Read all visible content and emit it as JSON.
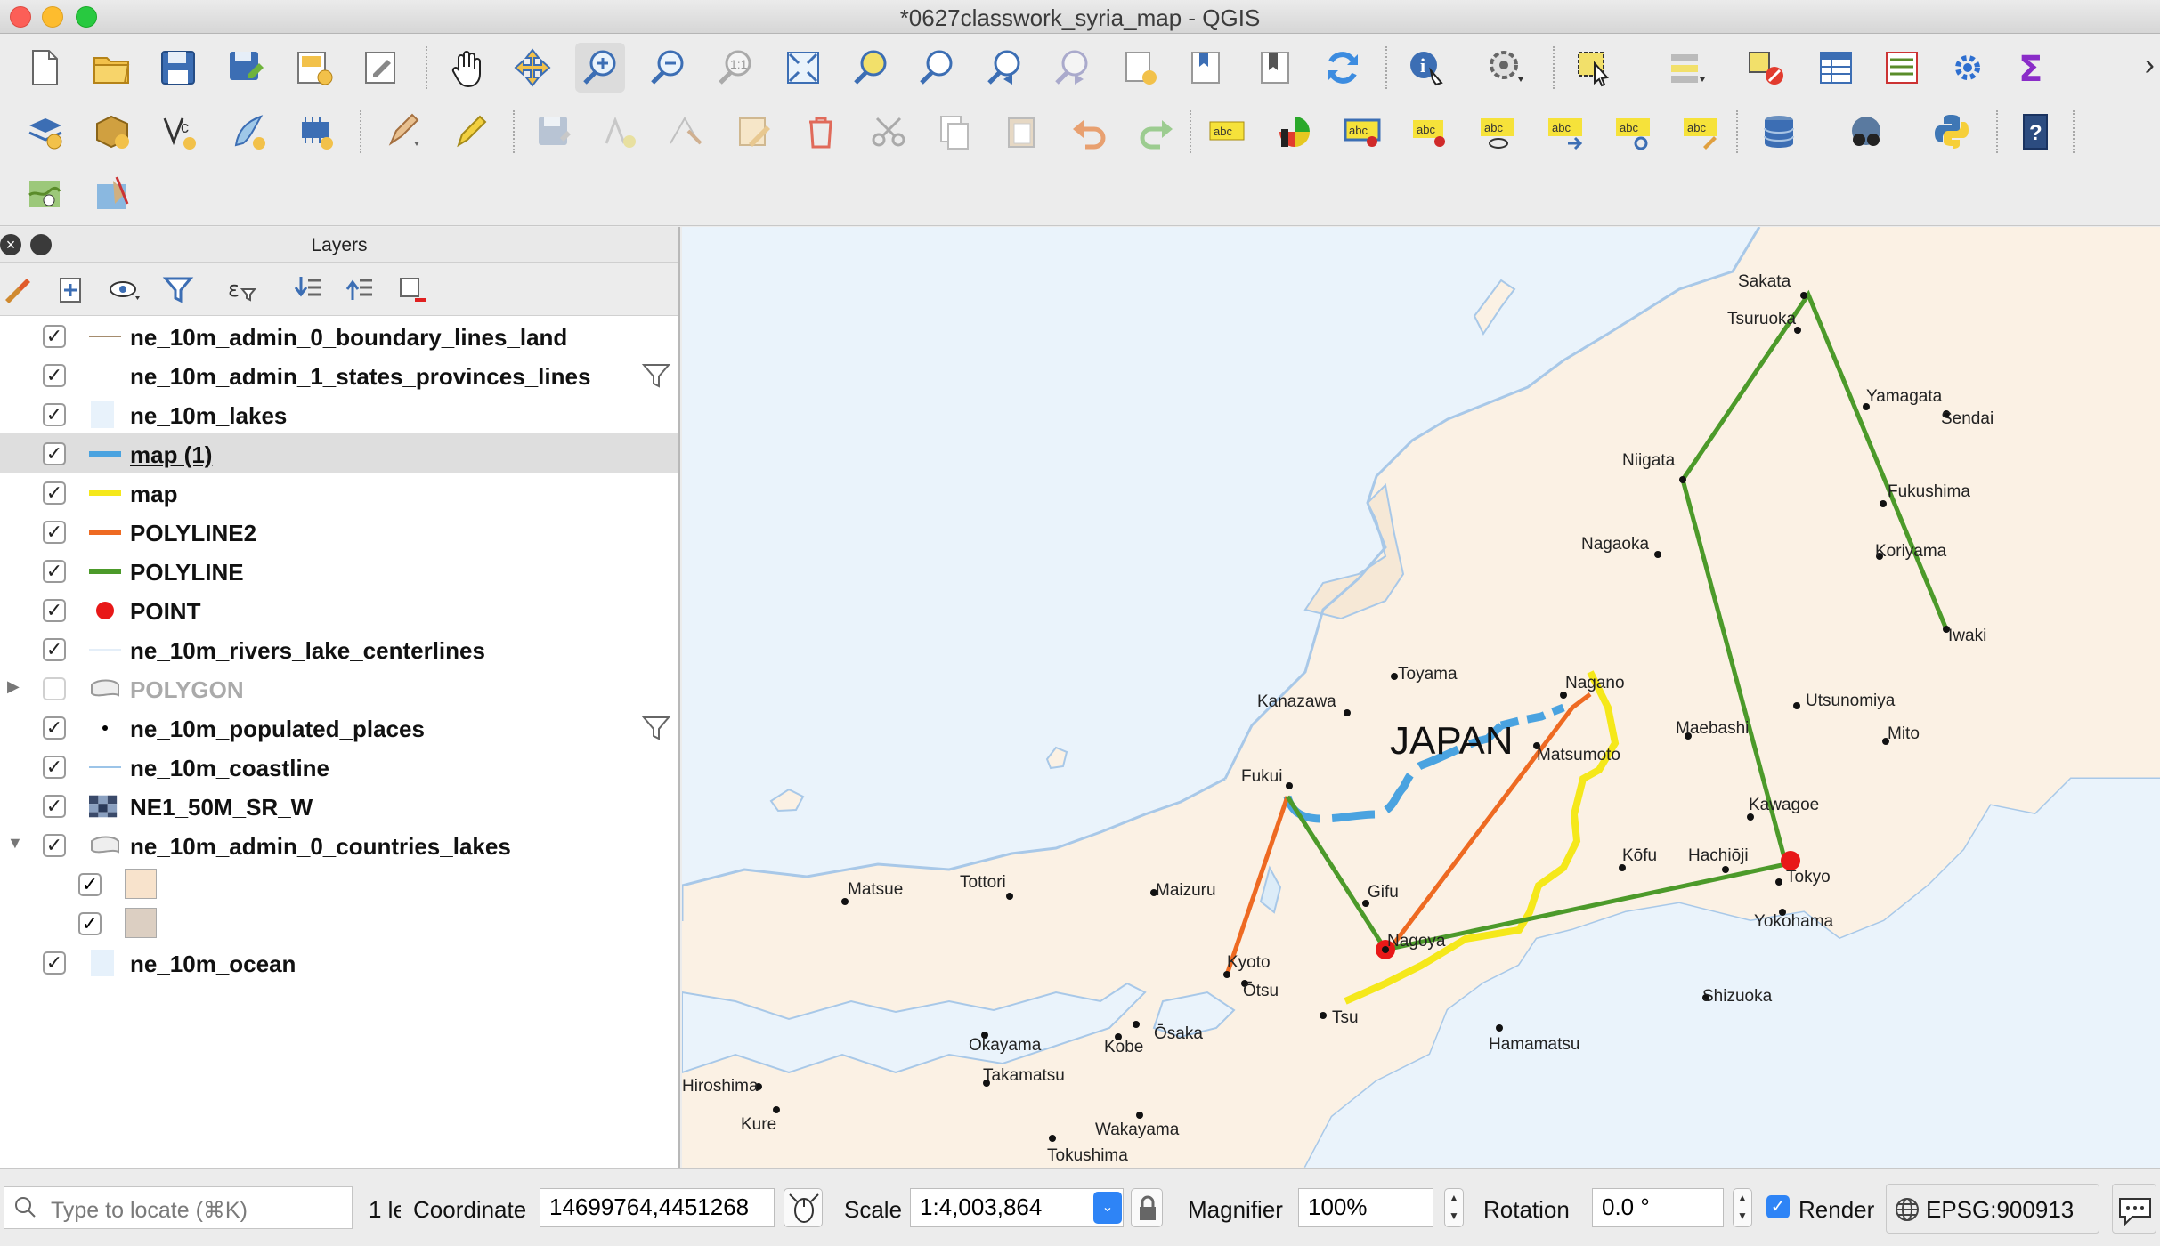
{
  "window": {
    "title": "*0627classwork_syria_map - QGIS"
  },
  "toolbar_icons": {
    "row1": [
      "new-project-icon",
      "open-project-icon",
      "save-project-icon",
      "save-as-icon",
      "new-print-layout-icon",
      "layout-manager-icon",
      "pan-icon",
      "pan-to-selection-icon",
      "zoom-in-icon",
      "zoom-out-icon",
      "zoom-actual-icon",
      "zoom-full-icon",
      "zoom-selection-icon",
      "zoom-layer-icon",
      "zoom-last-icon",
      "zoom-next-icon",
      "new-bookmark-icon",
      "show-bookmarks-icon",
      "map-tips-icon",
      "refresh-icon",
      "identify-icon",
      "run-feature-action-icon",
      "select-features-icon",
      "select-by-value-icon",
      "deselect-icon",
      "attribute-table-icon",
      "field-calculator-icon",
      "processing-toolbox-icon",
      "statistics-icon"
    ],
    "row2": [
      "data-source-manager-icon",
      "new-geopackage-icon",
      "new-shapefile-icon",
      "new-spatialite-icon",
      "new-virtual-layer-icon",
      "current-edits-icon",
      "toggle-editing-icon",
      "save-edits-icon",
      "add-feature-icon",
      "vertex-tool-icon",
      "modify-attributes-icon",
      "delete-selected-icon",
      "cut-features-icon",
      "copy-features-icon",
      "paste-features-icon",
      "undo-icon",
      "redo-icon",
      "label-icon",
      "diagram-icon",
      "pin-labels-icon",
      "highlight-pinned-icon",
      "show-hide-labels-icon",
      "move-label-icon",
      "rotate-label-icon",
      "change-label-icon",
      "db-manager-icon",
      "metasearch-icon",
      "python-console-icon",
      "help-icon"
    ],
    "row3": [
      "georeferencer-icon",
      "plugin-builder-icon"
    ]
  },
  "layers_panel": {
    "title": "Layers",
    "layers": [
      {
        "name": "ne_10m_admin_0_boundary_lines_land",
        "checked": true,
        "symbol": "line",
        "color": "#a58c6e"
      },
      {
        "name": "ne_10m_admin_1_states_provinces_lines",
        "checked": true,
        "symbol": "none",
        "color": "#ffffff",
        "filter": true
      },
      {
        "name": "ne_10m_lakes",
        "checked": true,
        "symbol": "fill",
        "color": "#e8f2fb"
      },
      {
        "name": "map (1)",
        "checked": true,
        "symbol": "line",
        "color": "#4aa3e0",
        "selected": true
      },
      {
        "name": "map",
        "checked": true,
        "symbol": "line",
        "color": "#f5e81a"
      },
      {
        "name": "POLYLINE2",
        "checked": true,
        "symbol": "line",
        "color": "#ee6a22"
      },
      {
        "name": "POLYLINE",
        "checked": true,
        "symbol": "line",
        "color": "#4c9a2a"
      },
      {
        "name": "POINT",
        "checked": true,
        "symbol": "point",
        "color": "#e81818"
      },
      {
        "name": "ne_10m_rivers_lake_centerlines",
        "checked": true,
        "symbol": "line",
        "color": "#e4eef8"
      },
      {
        "name": "POLYGON",
        "checked": false,
        "symbol": "polygon-group",
        "color": "#aaaaaa",
        "expander": "collapsed"
      },
      {
        "name": "ne_10m_populated_places",
        "checked": true,
        "symbol": "dot",
        "color": "#000000",
        "filter": true
      },
      {
        "name": "ne_10m_coastline",
        "checked": true,
        "symbol": "line",
        "color": "#9cc4e8"
      },
      {
        "name": "NE1_50M_SR_W",
        "checked": true,
        "symbol": "raster",
        "color": "#3a4a6a"
      },
      {
        "name": "ne_10m_admin_0_countries_lakes",
        "checked": true,
        "symbol": "polygon-group",
        "color": "#aaaaaa",
        "expander": "expanded"
      },
      {
        "name": "ne_10m_ocean",
        "checked": true,
        "symbol": "fill",
        "color": "#e6f1fb"
      }
    ],
    "sub_classes": [
      {
        "checked": true,
        "color": "#f8e3cc"
      },
      {
        "checked": true,
        "color": "#dccfc2"
      }
    ]
  },
  "map": {
    "country_label": "JAPAN",
    "cities": [
      "Sakata",
      "Tsuruoka",
      "Yamagata",
      "Sendai",
      "Niigata",
      "Fukushima",
      "Koriyama",
      "Nagaoka",
      "Iwaki",
      "Toyama",
      "Nagano",
      "Kanazawa",
      "Utsunomiya",
      "Maebashi",
      "Matsumoto",
      "Mito",
      "Fukui",
      "Kawagoe",
      "Kōfu",
      "Hachiōji",
      "Tokyo",
      "Matsue",
      "Tottori",
      "Maizuru",
      "Gifu",
      "Yokohama",
      "Nagoya",
      "Kyoto",
      "Ōtsu",
      "Shizuoka",
      "Tsu",
      "Ōsaka",
      "Okayama",
      "Kobe",
      "Hamamatsu",
      "Hiroshima",
      "Takamatsu",
      "Kure",
      "Wakayama",
      "Tokushima"
    ]
  },
  "status": {
    "search_placeholder": "Type to locate (⌘K)",
    "message": "1 le",
    "coordinate_label": "Coordinate",
    "coordinate": "14699764,4451268",
    "scale_label": "Scale",
    "scale": "1:4,003,864",
    "magnifier_label": "Magnifier",
    "magnifier": "100%",
    "rotation_label": "Rotation",
    "rotation": "0.0 °",
    "render_label": "Render",
    "render_checked": true,
    "crs": "EPSG:900913"
  }
}
